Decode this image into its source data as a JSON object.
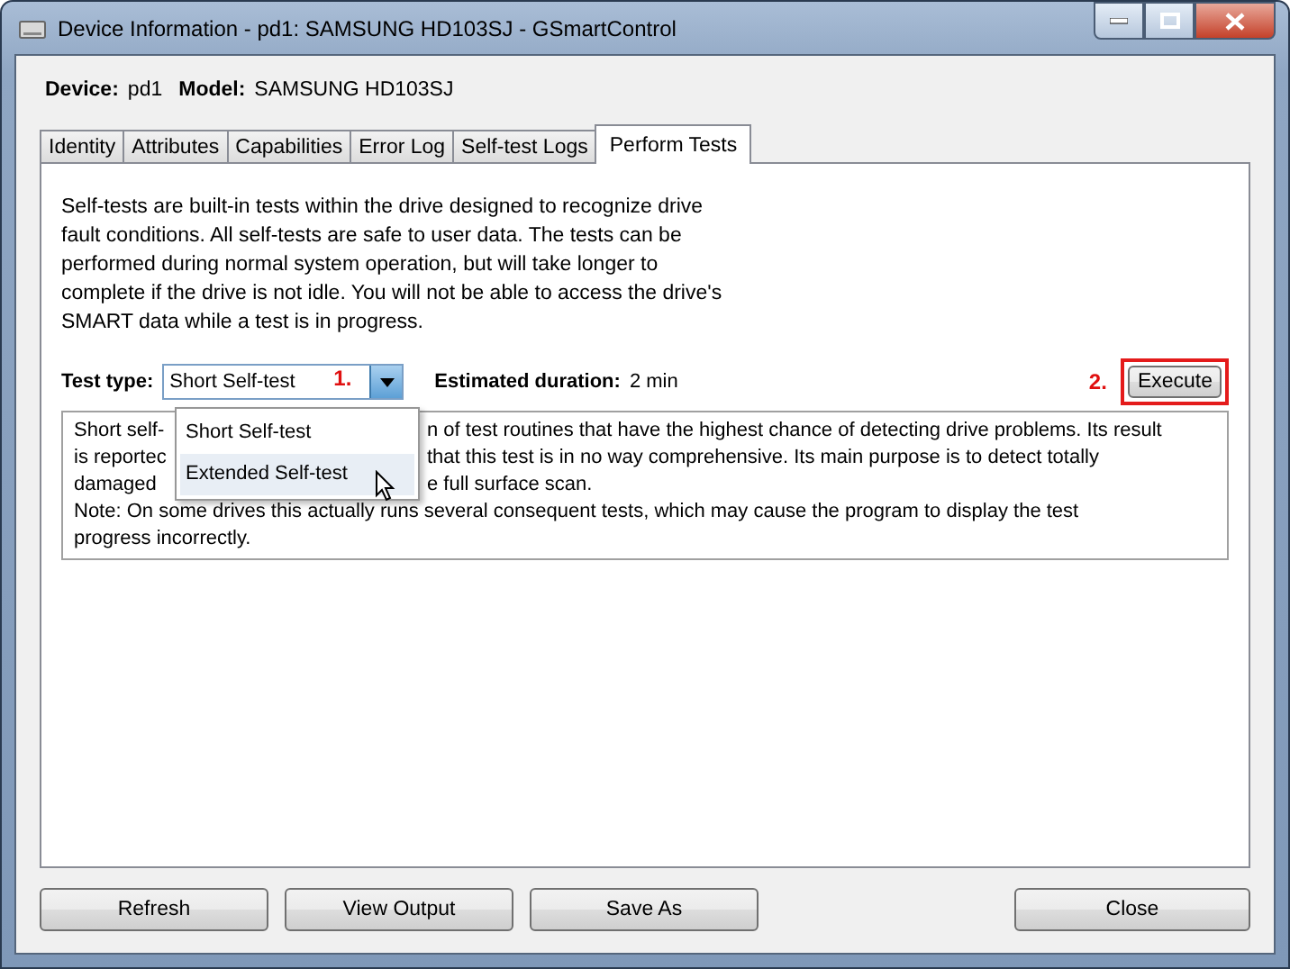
{
  "window": {
    "title": "Device Information - pd1: SAMSUNG HD103SJ - GSmartControl"
  },
  "device": {
    "device_label": "Device:",
    "device_value": "pd1",
    "model_label": "Model:",
    "model_value": "SAMSUNG HD103SJ"
  },
  "tabs": [
    {
      "label": "Identity",
      "selected": false
    },
    {
      "label": "Attributes",
      "selected": false
    },
    {
      "label": "Capabilities",
      "selected": false
    },
    {
      "label": "Error Log",
      "selected": false
    },
    {
      "label": "Self-test Logs",
      "selected": false
    },
    {
      "label": "Perform Tests",
      "selected": true
    }
  ],
  "intro": "Self-tests are built-in tests within the drive designed to recognize drive fault conditions. All self-tests are safe to user data. The tests can be performed during normal system operation, but will take longer to complete if the drive is not idle. You will not be able to access the drive's SMART data while a test is in progress.",
  "test_type": {
    "label": "Test type:",
    "value": "Short Self-test",
    "expanded": true,
    "options": [
      {
        "label": "Short Self-test",
        "highlighted": false
      },
      {
        "label": "Extended Self-test",
        "highlighted": true
      }
    ]
  },
  "duration": {
    "label": "Estimated duration:",
    "value": "2 min"
  },
  "execute_button": "Execute",
  "annotations": [
    "1.",
    "2."
  ],
  "description_lines": [
    {
      "left": "Short self-",
      "right": "n of test routines that have the highest chance of detecting drive problems. Its result"
    },
    {
      "left": "is reportec",
      "right": "that this test is in no way comprehensive. Its main purpose is to detect totally"
    },
    {
      "left": "damaged",
      "right": "e full surface scan."
    },
    {
      "left": "Note: On some drives this actually runs several consequent tests, which may cause the program to display the test"
    },
    {
      "left": "progress incorrectly."
    }
  ],
  "buttons": [
    "Refresh",
    "View Output",
    "Save As"
  ],
  "close_button": "Close"
}
